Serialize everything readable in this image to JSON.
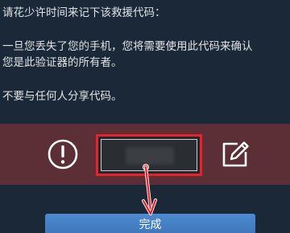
{
  "instructions": {
    "line1": "请花少许时间来记下该救援代码：",
    "line2": "一旦您丢失了您的手机，您将需要使用此代码来确认",
    "line3": "您是此验证器的所有者。",
    "line4": "不要与任何人分享代码。"
  },
  "rescue_code": {
    "value": ""
  },
  "actions": {
    "done_label": "完成"
  },
  "icons": {
    "warning": "exclamation-circle-icon",
    "edit": "pencil-square-icon",
    "annotation": "red-arrow-annotation"
  },
  "colors": {
    "background": "#1b2838",
    "band": "#5b2f35",
    "highlight": "#e8212a",
    "button": "#4680c6"
  }
}
